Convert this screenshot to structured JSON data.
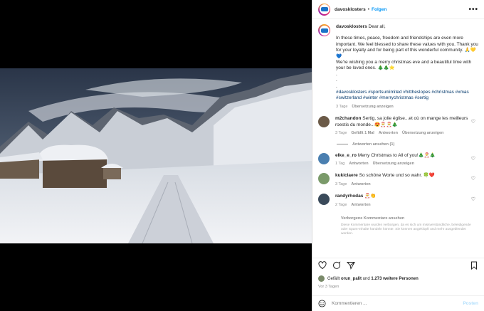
{
  "post": {
    "username": "davosklosters",
    "separator": "•",
    "follow_label": "Folgen",
    "more_label": "•••"
  },
  "caption": {
    "username": "davosklosters",
    "greeting": "Dear all,",
    "paragraph": "In these times, peace, freedom and friendships are even more important. We feel blessed to share these values with you. Thank you for your loyalty and for being part of this wonderful community. 🙏💛💙",
    "wish": "We're wishing you a merry christmas eve and a beautiful time with your be loved ones. 🎄🎄⭐",
    "dots": [
      ".",
      ".",
      "."
    ],
    "hashtags": "#davosklosters #sportsunlimited #hittheslopes #christmas #xmas #switzerland #winter #merrychristmas #sertig",
    "time": "3 Tage",
    "translate": "Übersetzung anzeigen"
  },
  "comments": [
    {
      "user": "m2chandon",
      "text": "Sertig, sa jolie église...et où on mange les meilleurs roestis du monde...😍🎅🎅🎄",
      "time": "3 Tage",
      "likes": "Gefällt 1 Mal",
      "reply": "Antworten",
      "translate": "Übersetzung anzeigen",
      "avatar_color": "#6b5a48"
    },
    {
      "user": "elke_e_ro",
      "text": "Merry Christmas to All of you!🎄🎅🎄",
      "time": "1 Tag",
      "reply": "Antworten",
      "translate": "Übersetzung anzeigen",
      "avatar_color": "#4a7fb0"
    },
    {
      "user": "kukiclaere",
      "text": "So schöne Worte und so wahr. 🍀❤️",
      "time": "3 Tage",
      "reply": "Antworten",
      "avatar_color": "#7a9a6a"
    },
    {
      "user": "randyrhodas",
      "text": "🎅👏",
      "time": "2 Tage",
      "reply": "Antworten",
      "avatar_color": "#3a4a5a"
    }
  ],
  "replies_label": "Antworten ansehen (1)",
  "hidden_comments_label": "Verborgene Kommentare ansehen",
  "hidden_note": "Diese Kommentare wurden verborgen, da es sich um missverständliche, beleidigende oder Spam-Inhalte handeln könnte. Sie können angeklopft und mehr ausgeblendet werden.",
  "likes": {
    "prefix": "Gefällt",
    "user": "orun_palit",
    "middle": "und",
    "count": "1.273 weitere Personen"
  },
  "time_ago": "Vor 3 Tagen",
  "composer": {
    "placeholder": "Kommentieren ...",
    "post_label": "Posten"
  },
  "icons": [
    "heart-icon",
    "comment-icon",
    "share-icon",
    "bookmark-icon",
    "emoji-icon",
    "more-icon"
  ]
}
